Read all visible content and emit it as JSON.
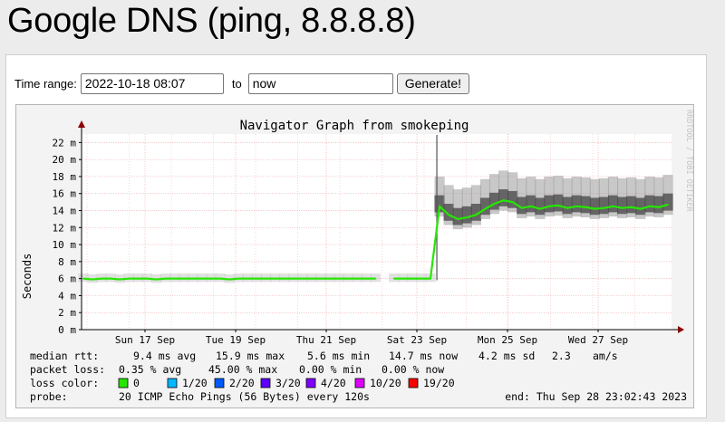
{
  "page": {
    "title": "Google DNS (ping, 8.8.8.8)"
  },
  "form": {
    "time_range_label": "Time range:",
    "start_value": "2022-10-18 08:07",
    "to_label": "to",
    "end_value": "now",
    "generate_label": "Generate!"
  },
  "graph": {
    "title": "Navigator Graph from smokeping",
    "watermark": "RRDTOOL / TOBI OETIKER",
    "stats": {
      "median_label": "median rtt:",
      "median_avg": "9.4 ms avg",
      "median_max": "15.9 ms max",
      "median_min": "5.6 ms min",
      "median_now": "14.7 ms now",
      "median_sd": "4.2 ms sd",
      "median_ams": "2.3",
      "median_ams_unit": "am/s",
      "loss_label": "packet loss:",
      "loss_avg": "0.35 % avg",
      "loss_max": "45.00 % max",
      "loss_min": "0.00 % min",
      "loss_now": "0.00 % now",
      "color_label": "loss color:",
      "probe_label": "probe:",
      "probe_text": "20 ICMP Echo Pings (56 Bytes) every 120s",
      "end_text": "end: Thu Sep 28 23:02:43 2023"
    },
    "loss_colors": [
      {
        "label": "0",
        "color": "#26e600"
      },
      {
        "label": "1/20",
        "color": "#00b8ff"
      },
      {
        "label": "2/20",
        "color": "#0059ff"
      },
      {
        "label": "3/20",
        "color": "#5e00ff"
      },
      {
        "label": "4/20",
        "color": "#7e00ff"
      },
      {
        "label": "10/20",
        "color": "#dd00ff"
      },
      {
        "label": "19/20",
        "color": "#ff0000"
      }
    ]
  },
  "chart_data": {
    "type": "line",
    "title": "Navigator Graph from smokeping",
    "ylabel": "Seconds",
    "y_unit": "m",
    "ylim": [
      0,
      23
    ],
    "y_ticks": [
      0,
      2,
      4,
      6,
      8,
      10,
      12,
      14,
      16,
      18,
      20,
      22
    ],
    "x_ticks": [
      "Sun 17 Sep",
      "Tue 19 Sep",
      "Thu 21 Sep",
      "Sat 23 Sep",
      "Mon 25 Sep",
      "Wed 27 Sep"
    ],
    "grid": true,
    "series": [
      {
        "values": [
          6.0,
          5.9,
          6.0,
          6.0,
          5.9,
          6.0,
          6.0,
          6.0,
          5.9,
          6.0,
          6.0,
          6.0,
          6.0,
          6.0,
          6.0,
          6.0,
          5.9,
          6.0,
          6.0,
          6.0,
          6.0,
          6.0,
          6.0,
          6.0,
          6.0,
          6.0,
          6.0,
          6.0,
          6.0,
          6.0,
          6.0,
          6.0,
          6.0,
          null,
          6.0,
          6.0,
          6.0,
          6.0,
          6.0,
          14.5,
          13.5,
          13.0,
          13.2,
          13.5,
          14.2,
          14.8,
          15.2,
          15.0,
          14.3,
          14.5,
          14.2,
          14.5,
          14.6,
          14.3,
          14.5,
          14.4,
          14.2,
          14.3,
          14.5,
          14.3,
          14.4,
          14.2,
          14.5,
          14.4,
          14.7
        ]
      }
    ]
  }
}
